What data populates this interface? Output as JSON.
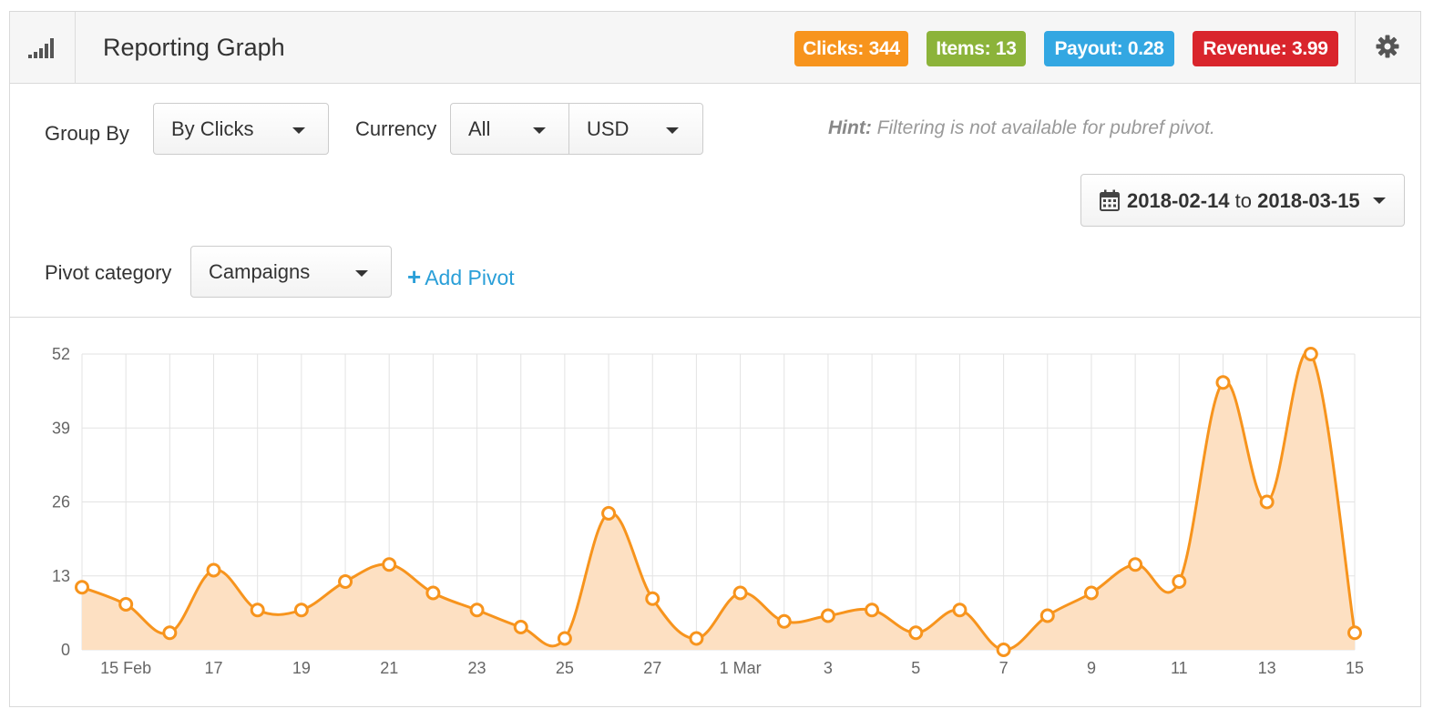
{
  "header": {
    "title": "Reporting Graph",
    "icon": "signal-bars-icon",
    "settings_icon": "gear-icon",
    "badges": [
      {
        "label": "Clicks: 344",
        "color": "#f7941d"
      },
      {
        "label": "Items: 13",
        "color": "#8cb33a"
      },
      {
        "label": "Payout: 0.28",
        "color": "#33a7e2"
      },
      {
        "label": "Revenue: 3.99",
        "color": "#d9252c"
      }
    ]
  },
  "filters": {
    "group_by_label": "Group By",
    "group_by_value": "By Clicks",
    "currency_label": "Currency",
    "currency_scope_value": "All",
    "currency_value": "USD",
    "hint_bold": "Hint:",
    "hint_text": " Filtering is not available for pubref pivot.",
    "date_from": "2018-02-14",
    "date_sep": " to ",
    "date_to": "2018-03-15",
    "pivot_label": "Pivot category",
    "pivot_value": "Campaigns",
    "add_pivot_label": "Add Pivot"
  },
  "chart_data": {
    "type": "area",
    "x": [
      "2018-02-14",
      "2018-02-15",
      "2018-02-16",
      "2018-02-17",
      "2018-02-18",
      "2018-02-19",
      "2018-02-20",
      "2018-02-21",
      "2018-02-22",
      "2018-02-23",
      "2018-02-24",
      "2018-02-25",
      "2018-02-26",
      "2018-02-27",
      "2018-02-28",
      "2018-03-01",
      "2018-03-02",
      "2018-03-03",
      "2018-03-04",
      "2018-03-05",
      "2018-03-06",
      "2018-03-07",
      "2018-03-08",
      "2018-03-09",
      "2018-03-10",
      "2018-03-11",
      "2018-03-12",
      "2018-03-13",
      "2018-03-14",
      "2018-03-15"
    ],
    "values": [
      11,
      8,
      3,
      14,
      7,
      7,
      12,
      15,
      10,
      7,
      4,
      2,
      24,
      9,
      2,
      10,
      5,
      6,
      7,
      3,
      7,
      0,
      6,
      10,
      15,
      12,
      47,
      26,
      52,
      3
    ],
    "x_tick_labels": [
      "15 Feb",
      "17",
      "19",
      "21",
      "23",
      "25",
      "27",
      "1 Mar",
      "3",
      "5",
      "7",
      "9",
      "11",
      "13",
      "15"
    ],
    "y_ticks": [
      0,
      13,
      26,
      39,
      52
    ],
    "ylim": [
      0,
      52
    ],
    "line_color": "#f7941d",
    "fill_color": "#fde0c2",
    "grid": true
  }
}
